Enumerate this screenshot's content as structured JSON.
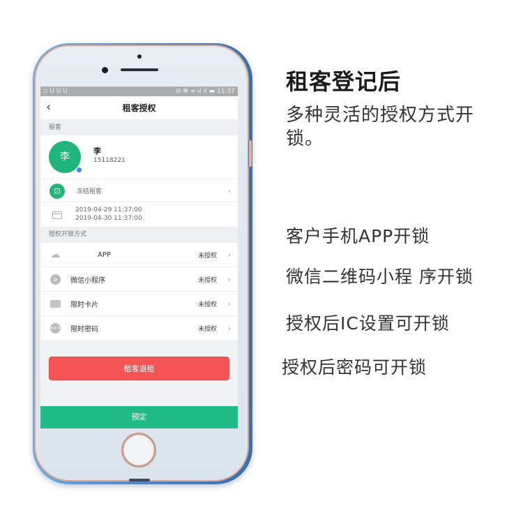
{
  "status_bar": {
    "left_icons": [
      "notification-icon",
      "app-icon",
      "app-icon",
      "app-icon"
    ],
    "right_icons": [
      "alarm-icon",
      "bluetooth-icon",
      "wifi-icon",
      "signal-icon",
      "signal-icon",
      "battery-icon"
    ],
    "time": "11:37"
  },
  "nav": {
    "back_glyph": "‹",
    "title": "租客授权"
  },
  "tenant_section": {
    "header": "租客",
    "avatar_text": "李",
    "badge_glyph": "◉",
    "name": "李",
    "phone": "15118221"
  },
  "freeze": {
    "icon_glyph": "🔓",
    "label": "冻结租客",
    "chevron": "›"
  },
  "dates": {
    "start": "2019-04-29 11:37:00",
    "end": "2019-04-30 11:37:00"
  },
  "methods_section": {
    "header": "授权开锁方式",
    "items": [
      {
        "icon": "cloud-icon",
        "glyph": "☁",
        "label": "APP",
        "status": "未授权",
        "chevron": "›"
      },
      {
        "icon": "link-icon",
        "glyph": "⊘",
        "label": "微信小程序",
        "status": "未授权",
        "chevron": "›"
      },
      {
        "icon": "card-icon",
        "glyph": "▭",
        "label": "限时卡片",
        "status": "未授权",
        "chevron": "›"
      },
      {
        "icon": "more-icon",
        "glyph": "•••",
        "label": "限时密码",
        "status": "未授权",
        "chevron": "›"
      }
    ]
  },
  "buttons": {
    "refund": "租客退租",
    "reserve": "预定"
  },
  "promo": {
    "headline": "租客登记后",
    "subline": "多种灵活的授权方式开锁。",
    "features": [
      "客户手机APP开锁",
      "微信二维码小程 序开锁",
      "授权后IC设置可开锁",
      "授权后密码可开锁"
    ]
  },
  "colors": {
    "brand_green": "#20b57a",
    "danger_red": "#f45454",
    "reserve_green": "#1fba86",
    "verify_blue": "#3c8cf0"
  }
}
